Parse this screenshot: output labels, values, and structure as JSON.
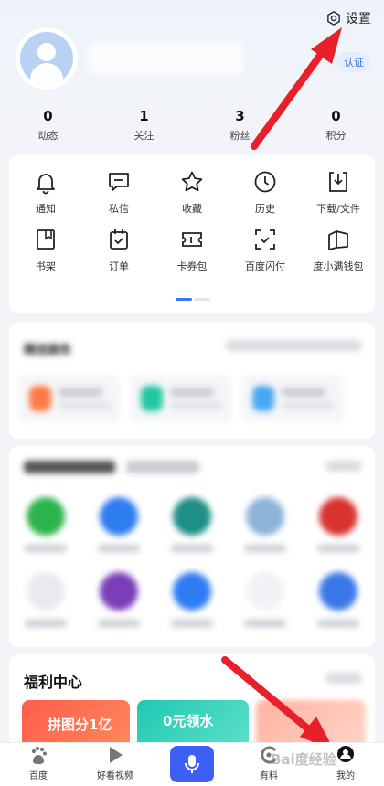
{
  "header": {
    "settings_label": "设置",
    "verify_label": "认证"
  },
  "stats": [
    {
      "value": "0",
      "label": "动态"
    },
    {
      "value": "1",
      "label": "关注"
    },
    {
      "value": "3",
      "label": "粉丝"
    },
    {
      "value": "0",
      "label": "积分"
    }
  ],
  "tools": [
    {
      "label": "通知",
      "icon": "bell-icon"
    },
    {
      "label": "私信",
      "icon": "message-icon"
    },
    {
      "label": "收藏",
      "icon": "star-icon"
    },
    {
      "label": "历史",
      "icon": "clock-icon"
    },
    {
      "label": "下载/文件",
      "icon": "download-icon"
    },
    {
      "label": "书架",
      "icon": "bookshelf-icon"
    },
    {
      "label": "订单",
      "icon": "order-icon"
    },
    {
      "label": "卡券包",
      "icon": "coupon-icon"
    },
    {
      "label": "百度闪付",
      "icon": "scan-pay-icon"
    },
    {
      "label": "度小满钱包",
      "icon": "wallet-icon"
    }
  ],
  "services": {
    "title": "精选服务"
  },
  "welfare": {
    "title": "福利中心",
    "promo1": "拼图分1亿",
    "promo2": "0元领水"
  },
  "tabbar": [
    {
      "label": "百度",
      "icon": "baidu-paw-icon"
    },
    {
      "label": "好看视频",
      "icon": "play-icon"
    },
    {
      "label": "",
      "icon": "mic-icon"
    },
    {
      "label": "有料",
      "icon": "youliao-icon"
    },
    {
      "label": "我的",
      "icon": "profile-icon"
    }
  ],
  "watermark": "Bai度经验",
  "colors": {
    "accent": "#3d5ff5",
    "annotation_arrow": "#e8202a"
  }
}
